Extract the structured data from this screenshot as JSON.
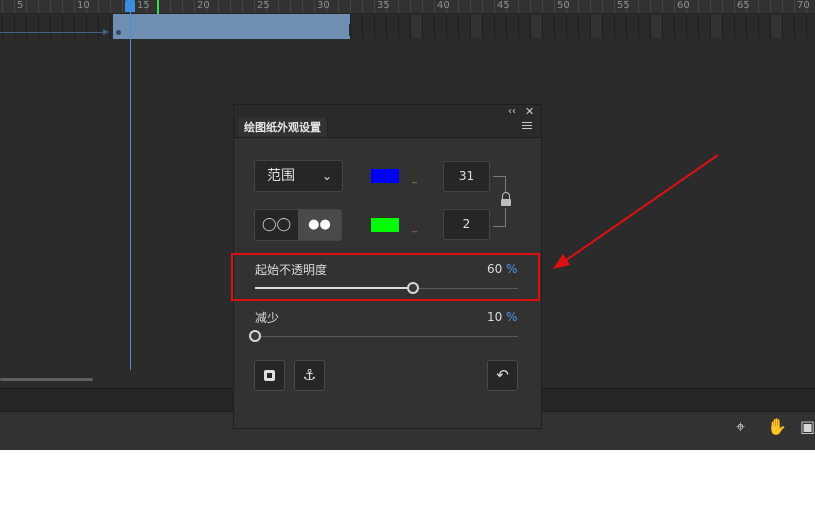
{
  "timeline": {
    "ruler_numbers": [
      "5",
      "10",
      "15",
      "20",
      "25",
      "30",
      "35",
      "40",
      "45",
      "50",
      "55",
      "60",
      "65",
      "70"
    ]
  },
  "panel": {
    "collapse_glyph": "‹‹",
    "close_glyph": "✕",
    "tab_title": "绘图纸外观设置",
    "range_label": "范围",
    "start_color": "#0000ff",
    "end_color": "#00ff00",
    "frame_count_top": "31",
    "frame_count_bottom": "2",
    "mode_icon_1": "◯◯",
    "mode_icon_2": "●●",
    "start_opacity": {
      "label": "起始不透明度",
      "value": "60",
      "unit": "%",
      "fraction": 0.6
    },
    "reduce": {
      "label": "减少",
      "value": "10",
      "unit": "%",
      "fraction": 0.0
    },
    "anchor_glyph": "⚓",
    "reset_glyph": "↶"
  },
  "status_icons": [
    "crosshair-icon",
    "hand-icon",
    "fit-frame-icon"
  ],
  "annotation_color": "#e01010"
}
